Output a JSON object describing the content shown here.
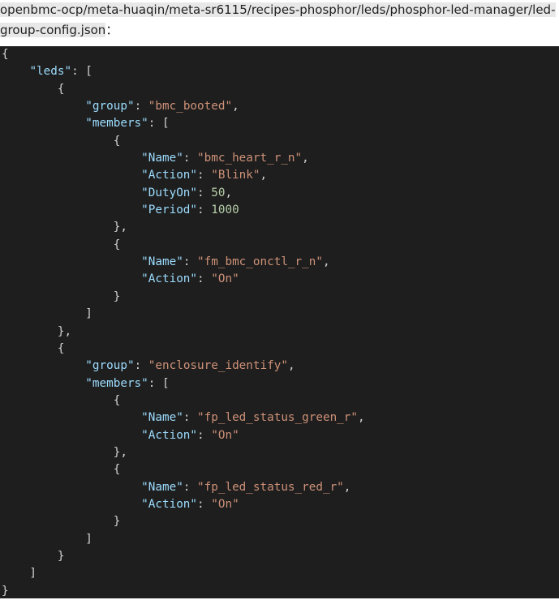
{
  "file_path": "openbmc-ocp/meta-huaqin/meta-sr6115/recipes-phosphor/leds/phosphor-led-manager/led-group-config.json",
  "file_path_suffix": "：",
  "code": {
    "lines": [
      [
        {
          "t": "p",
          "v": "{"
        }
      ],
      [
        {
          "t": "p",
          "v": "    "
        },
        {
          "t": "k",
          "v": "\"leds\""
        },
        {
          "t": "p",
          "v": ": ["
        }
      ],
      [
        {
          "t": "p",
          "v": "        {"
        }
      ],
      [
        {
          "t": "p",
          "v": "            "
        },
        {
          "t": "k",
          "v": "\"group\""
        },
        {
          "t": "p",
          "v": ": "
        },
        {
          "t": "s",
          "v": "\"bmc_booted\""
        },
        {
          "t": "p",
          "v": ","
        }
      ],
      [
        {
          "t": "p",
          "v": "            "
        },
        {
          "t": "k",
          "v": "\"members\""
        },
        {
          "t": "p",
          "v": ": ["
        }
      ],
      [
        {
          "t": "p",
          "v": "                {"
        }
      ],
      [
        {
          "t": "p",
          "v": "                    "
        },
        {
          "t": "k",
          "v": "\"Name\""
        },
        {
          "t": "p",
          "v": ": "
        },
        {
          "t": "s",
          "v": "\"bmc_heart_r_n\""
        },
        {
          "t": "p",
          "v": ","
        }
      ],
      [
        {
          "t": "p",
          "v": "                    "
        },
        {
          "t": "k",
          "v": "\"Action\""
        },
        {
          "t": "p",
          "v": ": "
        },
        {
          "t": "s",
          "v": "\"Blink\""
        },
        {
          "t": "p",
          "v": ","
        }
      ],
      [
        {
          "t": "p",
          "v": "                    "
        },
        {
          "t": "k",
          "v": "\"DutyOn\""
        },
        {
          "t": "p",
          "v": ": "
        },
        {
          "t": "n",
          "v": "50"
        },
        {
          "t": "p",
          "v": ","
        }
      ],
      [
        {
          "t": "p",
          "v": "                    "
        },
        {
          "t": "k",
          "v": "\"Period\""
        },
        {
          "t": "p",
          "v": ": "
        },
        {
          "t": "n",
          "v": "1000"
        }
      ],
      [
        {
          "t": "p",
          "v": "                },"
        }
      ],
      [
        {
          "t": "p",
          "v": "                {"
        }
      ],
      [
        {
          "t": "p",
          "v": "                    "
        },
        {
          "t": "k",
          "v": "\"Name\""
        },
        {
          "t": "p",
          "v": ": "
        },
        {
          "t": "s",
          "v": "\"fm_bmc_onctl_r_n\""
        },
        {
          "t": "p",
          "v": ","
        }
      ],
      [
        {
          "t": "p",
          "v": "                    "
        },
        {
          "t": "k",
          "v": "\"Action\""
        },
        {
          "t": "p",
          "v": ": "
        },
        {
          "t": "s",
          "v": "\"On\""
        }
      ],
      [
        {
          "t": "p",
          "v": "                }"
        }
      ],
      [
        {
          "t": "p",
          "v": "            ]"
        }
      ],
      [
        {
          "t": "p",
          "v": "        },"
        }
      ],
      [
        {
          "t": "p",
          "v": "        {"
        }
      ],
      [
        {
          "t": "p",
          "v": "            "
        },
        {
          "t": "k",
          "v": "\"group\""
        },
        {
          "t": "p",
          "v": ": "
        },
        {
          "t": "s",
          "v": "\"enclosure_identify\""
        },
        {
          "t": "p",
          "v": ","
        }
      ],
      [
        {
          "t": "p",
          "v": "            "
        },
        {
          "t": "k",
          "v": "\"members\""
        },
        {
          "t": "p",
          "v": ": ["
        }
      ],
      [
        {
          "t": "p",
          "v": "                {"
        }
      ],
      [
        {
          "t": "p",
          "v": "                    "
        },
        {
          "t": "k",
          "v": "\"Name\""
        },
        {
          "t": "p",
          "v": ": "
        },
        {
          "t": "s",
          "v": "\"fp_led_status_green_r\""
        },
        {
          "t": "p",
          "v": ","
        }
      ],
      [
        {
          "t": "p",
          "v": "                    "
        },
        {
          "t": "k",
          "v": "\"Action\""
        },
        {
          "t": "p",
          "v": ": "
        },
        {
          "t": "s",
          "v": "\"On\""
        }
      ],
      [
        {
          "t": "p",
          "v": "                },"
        }
      ],
      [
        {
          "t": "p",
          "v": "                {"
        }
      ],
      [
        {
          "t": "p",
          "v": "                    "
        },
        {
          "t": "k",
          "v": "\"Name\""
        },
        {
          "t": "p",
          "v": ": "
        },
        {
          "t": "s",
          "v": "\"fp_led_status_red_r\""
        },
        {
          "t": "p",
          "v": ","
        }
      ],
      [
        {
          "t": "p",
          "v": "                    "
        },
        {
          "t": "k",
          "v": "\"Action\""
        },
        {
          "t": "p",
          "v": ": "
        },
        {
          "t": "s",
          "v": "\"On\""
        }
      ],
      [
        {
          "t": "p",
          "v": "                }"
        }
      ],
      [
        {
          "t": "p",
          "v": "            ]"
        }
      ],
      [
        {
          "t": "p",
          "v": "        }"
        }
      ],
      [
        {
          "t": "p",
          "v": "    ]"
        }
      ],
      [
        {
          "t": "p",
          "v": "}"
        }
      ]
    ]
  },
  "colors": {
    "code_background": "#1e1e1e",
    "key": "#9cdcfe",
    "string": "#ce9178",
    "number": "#b5cea8",
    "punctuation": "#d4d4d4",
    "path_highlight": "#e8e8e8"
  }
}
